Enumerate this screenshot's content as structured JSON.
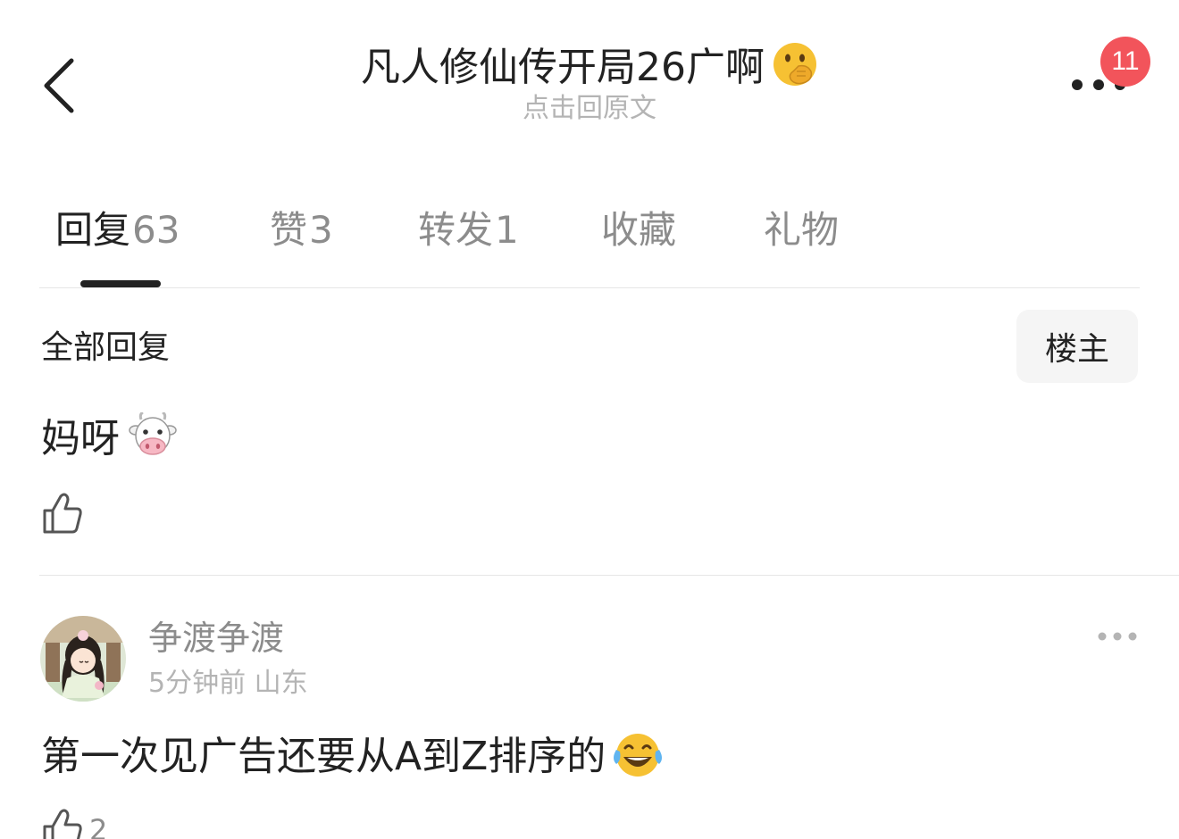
{
  "header": {
    "title": "凡人修仙传开局26广啊",
    "title_emoji": "face-with-hand-over-mouth-emoji",
    "subtitle": "点击回原文",
    "notification_count": "11"
  },
  "tabs": [
    {
      "label": "回复",
      "count": "63",
      "active": true
    },
    {
      "label": "赞",
      "count": "3",
      "active": false
    },
    {
      "label": "转发",
      "count": "1",
      "active": false
    },
    {
      "label": "收藏",
      "count": "",
      "active": false
    },
    {
      "label": "礼物",
      "count": "",
      "active": false
    }
  ],
  "filter": {
    "label": "全部回复",
    "op_button": "楼主"
  },
  "comments": [
    {
      "text": "妈呀",
      "emoji": "cow-face-emoji",
      "likes": ""
    },
    {
      "username": "争渡争渡",
      "time": "5分钟前",
      "location": "山东",
      "text": "第一次见广告还要从A到Z排序的",
      "emoji": "tears-of-joy-emoji",
      "likes": "2"
    }
  ],
  "colors": {
    "accent_text": "#222222",
    "muted_text": "#8c8c8c",
    "light_text": "#b4b4b4",
    "badge": "#f2545b"
  }
}
